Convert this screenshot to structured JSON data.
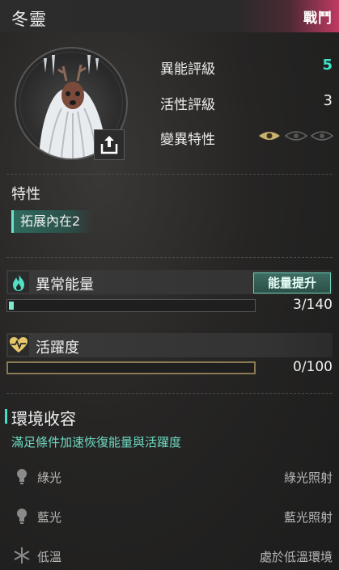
{
  "header": {
    "title": "冬靈",
    "badge": "戰鬥"
  },
  "stats": [
    {
      "label": "異能評級",
      "value": "5"
    },
    {
      "label": "活性評級",
      "value": "3"
    },
    {
      "label": "變異特性",
      "value": ""
    }
  ],
  "mutation_eyes": {
    "filled": 1,
    "total": 3
  },
  "traits": {
    "title": "特性",
    "items": [
      "拓展內在2"
    ]
  },
  "energy": {
    "title": "異常能量",
    "button": "能量提升",
    "value_text": "3/140",
    "fraction": 0.021
  },
  "vitality": {
    "title": "活躍度",
    "value_text": "0/100",
    "fraction": 0.0
  },
  "environment": {
    "title": "環境收容",
    "subtitle": "滿足條件加速恢復能量與活躍度",
    "conditions": [
      {
        "icon": "bulb-icon",
        "label": "綠光",
        "requirement": "綠光照射"
      },
      {
        "icon": "bulb-icon",
        "label": "藍光",
        "requirement": "藍光照射"
      },
      {
        "icon": "snowflake-icon",
        "label": "低溫",
        "requirement": "處於低溫環境"
      }
    ]
  },
  "colors": {
    "accent": "#3fe0c6",
    "badge_bg": "#c03a63",
    "vitality": "#d8c58b"
  }
}
